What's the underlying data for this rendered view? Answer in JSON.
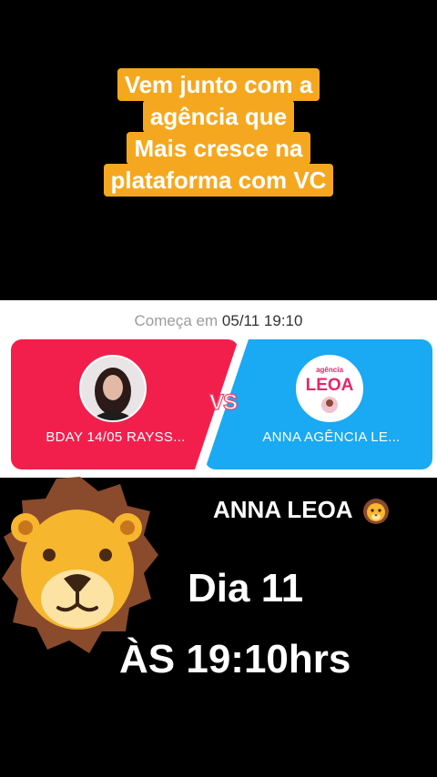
{
  "caption": {
    "lines": [
      "Vem junto com a",
      "agência que",
      "Mais cresce na",
      "plataforma com VC"
    ]
  },
  "battle": {
    "starts_label": "Começa em",
    "starts_date": "05/11 19:10",
    "left_name": "BDAY 14/05 RAYSS...",
    "right_name": "ANNA AGÊNCIA LE...",
    "vs_label": "VS",
    "right_logo_top": "agência",
    "right_logo_main": "LEOA"
  },
  "overlay": {
    "title": "ANNA LEOA",
    "day": "Dia 11",
    "time": "ÀS 19:10hrs"
  },
  "colors": {
    "caption_bg": "#f5a81f",
    "left_team": "#f21f4d",
    "right_team": "#1aa9f3"
  },
  "icons": {
    "lion": "lion-face-icon"
  }
}
